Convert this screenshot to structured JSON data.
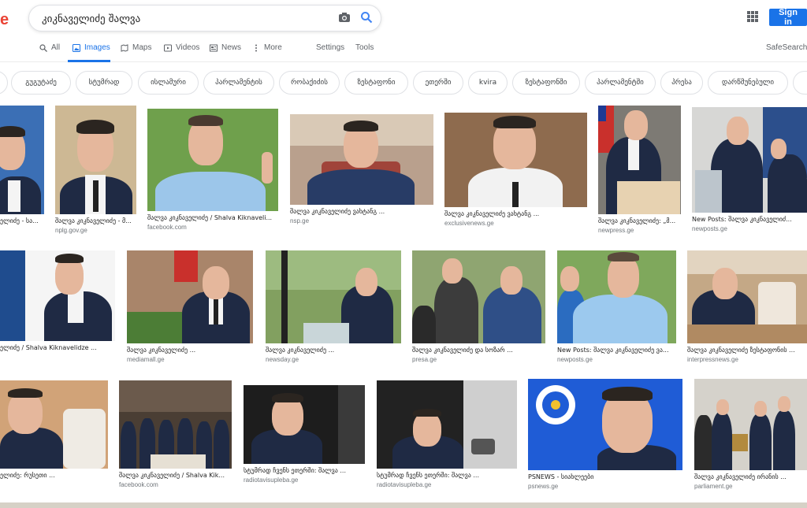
{
  "logo": "e",
  "search": {
    "query": "კიკნაველიძე შალვა"
  },
  "header": {
    "signin": "Sign in",
    "safesearch": "SafeSearch"
  },
  "tabs": [
    {
      "label": "All",
      "icon": "search-icon"
    },
    {
      "label": "Images",
      "icon": "image-icon",
      "active": true
    },
    {
      "label": "Maps",
      "icon": "map-icon"
    },
    {
      "label": "Videos",
      "icon": "video-icon"
    },
    {
      "label": "News",
      "icon": "news-icon"
    },
    {
      "label": "More",
      "icon": "more-vert-icon"
    },
    {
      "label": "Settings"
    },
    {
      "label": "Tools"
    }
  ],
  "chips": [
    "გუგუტაძე",
    "სტუმრად",
    "ისლამური",
    "პარლამენტის",
    "რობაქიძის",
    "ზესტაფონი",
    "ეთერში",
    "kvira",
    "ზესტაფონში",
    "პარლამენტში",
    "პრესა",
    "დარწმუნებული"
  ],
  "results": [
    {
      "caption": "ელიძე - სა...",
      "source": ""
    },
    {
      "caption": "შალვა კიკნაველიძე - მ...",
      "source": "nplg.gov.ge"
    },
    {
      "caption": "შალვა კიკნაველიძე / Shalva Kiknaveli...",
      "source": "facebook.com"
    },
    {
      "caption": "შალვა კიკნაველიძე ვახტანგ ...",
      "source": "nsp.ge"
    },
    {
      "caption": "შალვა კიკნაველიძე ვახტანგ ...",
      "source": "exclusivenews.ge"
    },
    {
      "caption": "შალვა კიკნაველიძე: „მ...",
      "source": "newpress.ge"
    },
    {
      "caption": "New Posts: შალვა კიკნაველიძ...",
      "source": "newposts.ge"
    },
    {
      "caption": "ელიძე / Shalva Kiknavelidze ...",
      "source": ""
    },
    {
      "caption": "შალვა კიკნაველიძე ...",
      "source": "mediamall.ge"
    },
    {
      "caption": "შალვა კიკნაველიძე ...",
      "source": "newsday.ge"
    },
    {
      "caption": "შალვა კიკნაველიძე და სოზარ ...",
      "source": "presa.ge"
    },
    {
      "caption": "New Posts: შალვა კიკნაველიძე ვა...",
      "source": "newposts.ge"
    },
    {
      "caption": "შალვა კიკნაველიძე ზესტაფონის ...",
      "source": "interpressnews.ge"
    },
    {
      "caption": "ელიძე: რუსეთი ...",
      "source": ""
    },
    {
      "caption": "შალვა კიკნაველიძე / Shalva Kik...",
      "source": "facebook.com"
    },
    {
      "caption": "სტუმრად ჩვენს ეთერში: შალვა ...",
      "source": "radiotavisupleba.ge"
    },
    {
      "caption": "სტუმრად ჩვენს ეთერში: შალვა ...",
      "source": "radiotavisupleba.ge"
    },
    {
      "caption": "PSNEWS - სიახლეები",
      "source": "psnews.ge"
    },
    {
      "caption": "შალვა კიკნაველიძე ირანის ...",
      "source": "parliament.ge"
    }
  ],
  "colors": {
    "accent": "#1a73e8",
    "signin_bg": "#1a73e8",
    "logo": "#ea4335"
  }
}
